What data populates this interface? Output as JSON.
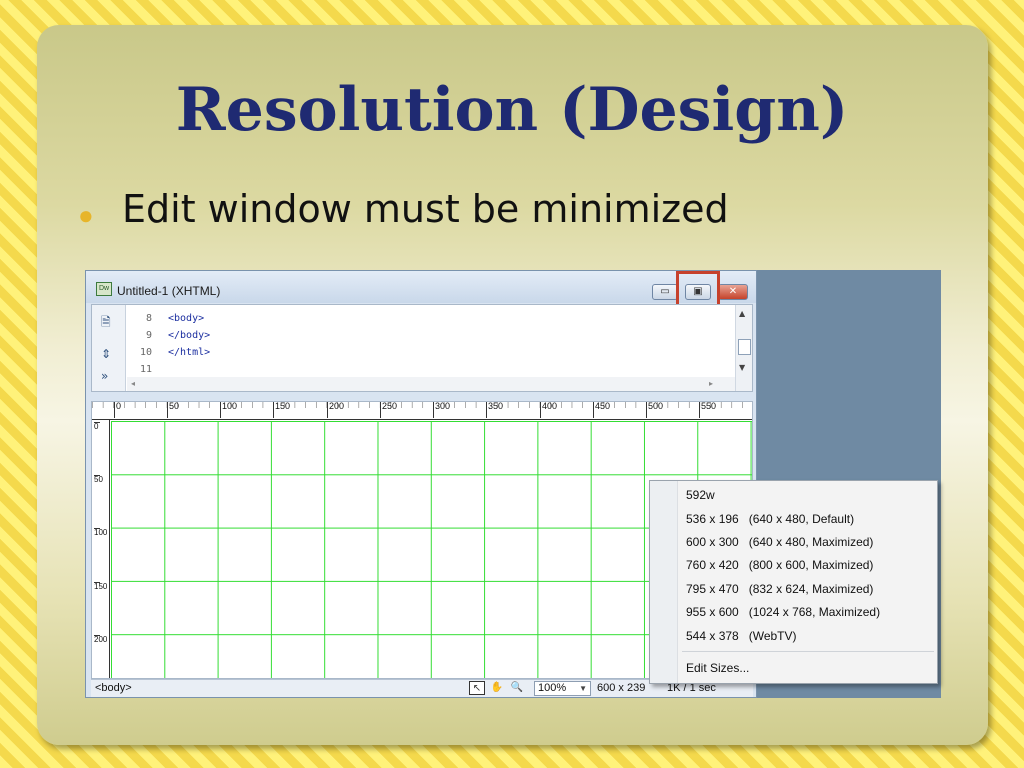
{
  "slide": {
    "title": "Resolution (Design)",
    "bullet": "Edit window must be minimized"
  },
  "window": {
    "title": "Untitled-1 (XHTML)",
    "icon_label": "Dw",
    "buttons": {
      "minimize": "▭",
      "restore": "▣",
      "close": "✕"
    }
  },
  "code": {
    "line_numbers": [
      "8",
      "9",
      "10",
      "11"
    ],
    "lines": [
      "<body>",
      "</body>",
      "</html>",
      ""
    ]
  },
  "ruler": {
    "top_ticks": [
      "0",
      "50",
      "100",
      "150",
      "200",
      "250",
      "300",
      "350",
      "400",
      "450",
      "500",
      "550"
    ],
    "left_ticks": [
      "0",
      "50",
      "100",
      "150",
      "200"
    ]
  },
  "status": {
    "tag": "<body>",
    "zoom": "100%",
    "size": "600 x 239",
    "speed": "1K / 1 sec"
  },
  "menu": {
    "items": [
      "592w",
      "536 x 196   (640 x 480, Default)",
      "600 x 300   (640 x 480, Maximized)",
      "760 x 420   (800 x 600, Maximized)",
      "795 x 470   (832 x 624, Maximized)",
      "955 x 600   (1024 x 768, Maximized)",
      "544 x 378   (WebTV)"
    ],
    "edit_sizes": "Edit Sizes..."
  },
  "colors": {
    "title": "#1f2a72",
    "bullet": "#e7b52a",
    "grid": "#33dd33",
    "highlight": "#c6412c"
  }
}
